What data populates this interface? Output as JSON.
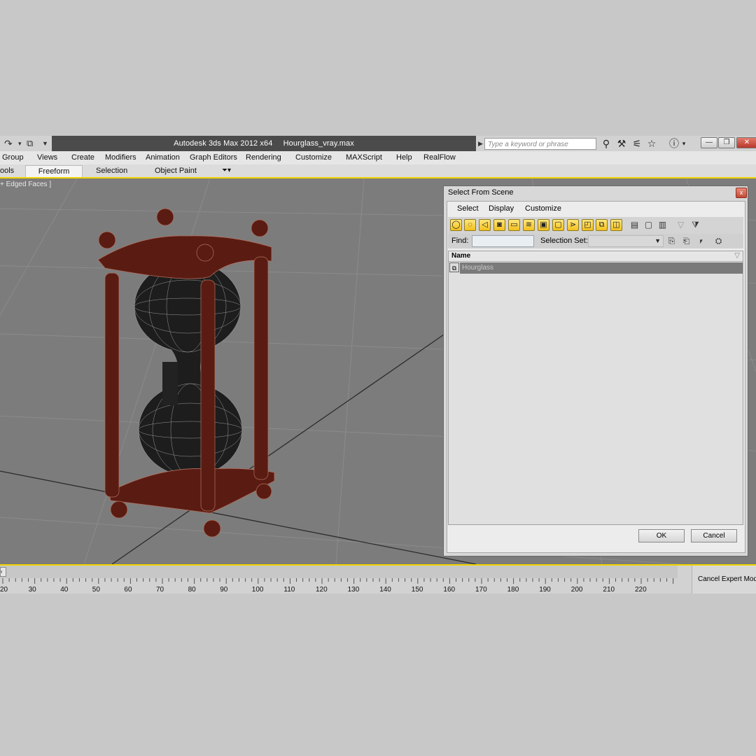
{
  "app": {
    "title": "Autodesk 3ds Max  2012 x64",
    "file": "Hourglass_vray.max"
  },
  "search": {
    "placeholder": "Type a keyword or phrase"
  },
  "icons": {
    "redo": "redo-icon",
    "dropdown": "chevron-down-icon",
    "binoculars": "binoculars-icon",
    "tools": "tools-icon",
    "satellite": "satellite-icon",
    "star": "star-icon",
    "help": "help-icon",
    "minimize": "minimize-icon",
    "restore": "restore-icon",
    "close": "close-icon"
  },
  "menu": [
    "Group",
    "Views",
    "Create",
    "Modifiers",
    "Animation",
    "Graph Editors",
    "Rendering",
    "Customize",
    "MAXScript",
    "Help",
    "RealFlow"
  ],
  "ribbon": {
    "tabs": [
      "ools",
      "Freeform",
      "Selection",
      "Object Paint"
    ]
  },
  "viewport": {
    "label": "+ Edged Faces ]"
  },
  "dialog": {
    "title": "Select From Scene",
    "close_glyph": "x",
    "menu": [
      "Select",
      "Display",
      "Customize"
    ],
    "find_label": "Find:",
    "selection_set_label": "Selection Set:",
    "column_name": "Name",
    "rows": [
      "Hourglass"
    ],
    "ok_label": "OK",
    "cancel_label": "Cancel"
  },
  "timeline": {
    "ticks": [
      20,
      30,
      40,
      50,
      60,
      70,
      80,
      90,
      100,
      110,
      120,
      130,
      140,
      150,
      160,
      170,
      180,
      190,
      200,
      210,
      220
    ],
    "cancel_expert": "Cancel Expert Mode"
  },
  "colors": {
    "accent_yellow": "#f0d400",
    "title_dark": "#4b4b4b",
    "viewport_bg": "#7c7c7c",
    "wood": "#5a1c12"
  }
}
